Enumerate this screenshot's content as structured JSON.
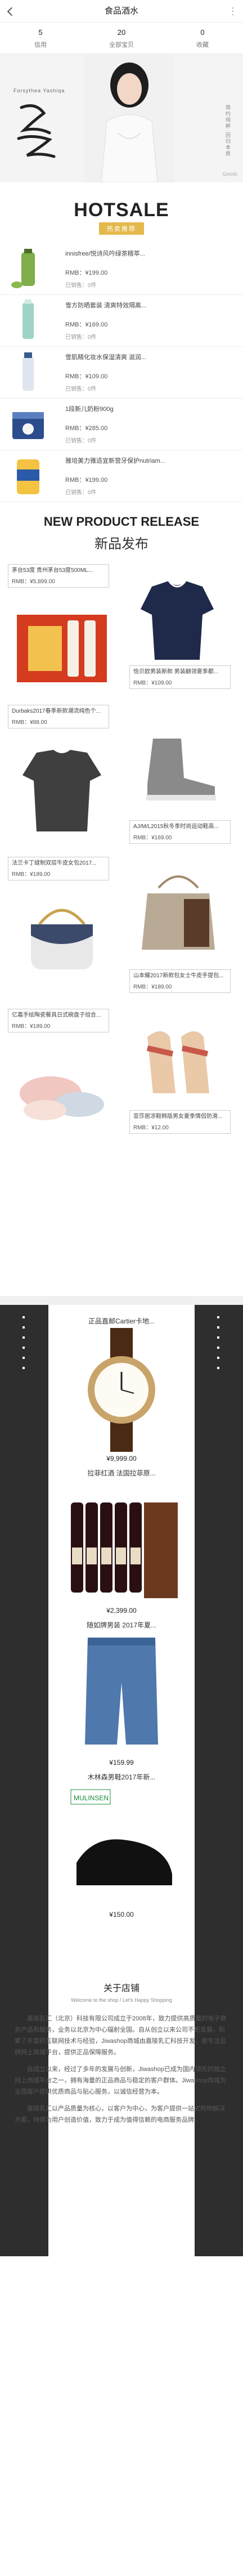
{
  "header": {
    "title": "食品酒水",
    "back_label": "‹",
    "more_label": "⋮"
  },
  "stats": [
    {
      "num": "5",
      "label": "信用"
    },
    {
      "num": "20",
      "label": "全部宝贝"
    },
    {
      "num": "0",
      "label": "收藏"
    }
  ],
  "hero": {
    "brandline": "Forsythea Yashiqa",
    "tagline": "简约纯粹·回归本质",
    "goods": "Goods"
  },
  "hotsale": {
    "title": "HOTSALE",
    "subtitle": "热卖推荐"
  },
  "hot_items": [
    {
      "name": "innisfree/悦诗风吟绿茶精萃...",
      "price": "RMB：¥199.00",
      "sold": "已销售：0件"
    },
    {
      "name": "雪方防晒套装 清爽特效隔离...",
      "price": "RMB：¥169.00",
      "sold": "已销售：0件"
    },
    {
      "name": "雪肌精化妆水保湿清爽 滋润...",
      "price": "RMB：¥109.00",
      "sold": "已销售：0件"
    },
    {
      "name": "1段新儿奶粉900g",
      "price": "RMB：¥285.00",
      "sold": "已销售：0件"
    },
    {
      "name": "雅培美力雅适宜新营牙保护nutriam...",
      "price": "RMB：¥199.00",
      "sold": "已销售：0件"
    }
  ],
  "newprod": {
    "title": "NEW PRODUCT RELEASE",
    "cn": "新品发布"
  },
  "zz_cards": [
    {
      "name": "茅台53度 贵州茅台53度500ML...",
      "price": "RMB：¥5,899.00"
    },
    {
      "name": "恰贝欧男装新款 男装翻领夏季都...",
      "price": "RMB：¥109.00"
    },
    {
      "name": "Durbaks2017春季新款潮流纯色个...",
      "price": "RMB：¥88.00"
    },
    {
      "name": "AJ/M/L2015秋冬季时尚运动鞋高...",
      "price": "RMB：¥169.00"
    },
    {
      "name": "法兰卡丁缝制双层牛皮女包2017...",
      "price": "RMB：¥189.00"
    },
    {
      "name": "山本耀2017新款包女士牛皮手提包...",
      "price": "RMB：¥189.00"
    },
    {
      "name": "亿嘉手绘陶瓷餐具日式碗盘子组合...",
      "price": "RMB：¥189.00"
    },
    {
      "name": "亚莎居凉鞋韩版男女夏季情侣防滑...",
      "price": "RMB：¥12.00"
    }
  ],
  "dark_products": [
    {
      "name": "正品直邮Cartier卡地...",
      "price": "¥9,999.00"
    },
    {
      "name": "拉菲红酒 法国拉菲原...",
      "price": "¥2,399.00"
    },
    {
      "name": "随如牌男装 2017年夏...",
      "price": "¥159.99"
    },
    {
      "name": "木林森男鞋2017年新...",
      "price": "¥150.00"
    }
  ],
  "about": {
    "title": "关于店铺",
    "en": "Welcome to the shop / Let's Happy Shopping",
    "p1": "嘉陵乳汇（北京）科技有限公司成立于2008年，致力提供高质量的电子商务产品和服务，业务以北京为中心辐射全国。自从创立以来公司不断发展，积累了丰富的互联网技术与经验，Jiwashop商城由嘉陵乳汇科技开发，是专注品牌网上商城平台，提供正品保障服务。",
    "p2": "自成立以来，经过了多年的发展与创新，Jiwashop已成为国内领先的独立网上商城平台之一，拥有海量的正品商品与稳定的客户群体。Jiwashop商城为全国客户提供优质商品与贴心服务，以诚信经营为本。",
    "p3": "嘉陵乳汇以产品质量为核心，以客户为中心，为客户提供一站式购物解决方案，持续为用户创造价值，致力于成为值得信赖的电商服务品牌。"
  },
  "colors": {
    "accent": "#e3b94b",
    "dark_strip": "#2e2e2e"
  }
}
